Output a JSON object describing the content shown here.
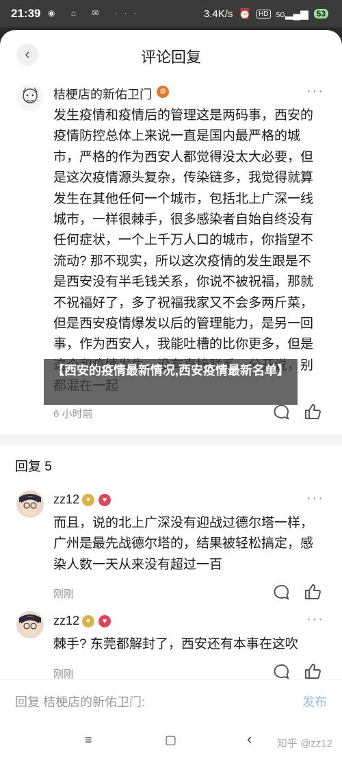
{
  "status_bar": {
    "time": "21:39",
    "left_icons": "◉ ⌂ ✉ ···",
    "speed": "3.4K/s",
    "hd": "HD",
    "signal": "5G",
    "battery": "53"
  },
  "header": {
    "title": "评论回复",
    "back_icon": "chevron-left"
  },
  "main_comment": {
    "username": "桔梗店的新佑卫门",
    "badge": "⚙",
    "more": "···",
    "text": "发生疫情和疫情后的管理这是两码事，西安的疫情防控总体上来说一直是国内最严格的城市，严格的作为西安人都觉得没太大必要，但是这次疫情源头复杂，传染链多，我觉得就算发生在其他任何一个城市，包括北上广深一线城市，一样很棘手，很多感染者自始自终没有任何症状，一个上千万人口的城市，你指望不流动? 那不现实，所以这次疫情的发生跟是不是西安没有半毛钱关系，你说不被祝福，那就不祝福好了，多了祝福我家又不会多两斤菜，但是西安疫情爆发以后的管理能力，是另一回事，作为西安人，我能吐槽的比你更多，但是这个和疫情发生，没有直接联系，分开说，别都混在一起",
    "time": "6 小时前"
  },
  "overlay_caption": "【西安的疫情最新情况,西安疫情最新名单】",
  "replies_section": {
    "title": "回复 5"
  },
  "replies": [
    {
      "username": "zz12",
      "text": "而且，说的北上广深没有迎战过德尔塔一样，广州是最先战德尔塔的，结果被轻松搞定，感染人数一天从来没有超过一百",
      "time": "刚刚"
    },
    {
      "username": "zz12",
      "text": "棘手? 东莞都解封了，西安还有本事在这吹",
      "time": "刚刚"
    }
  ],
  "reply_bar": {
    "placeholder": "回复 桔梗店的新佑卫门:",
    "publish": "发布"
  },
  "nav": {
    "menu": "≡",
    "home": "▢",
    "back": "‹",
    "watermark": "知乎 @zz12"
  },
  "colors": {
    "accent": "#056de8",
    "publish": "#9ab8e6",
    "muted": "#999999"
  }
}
